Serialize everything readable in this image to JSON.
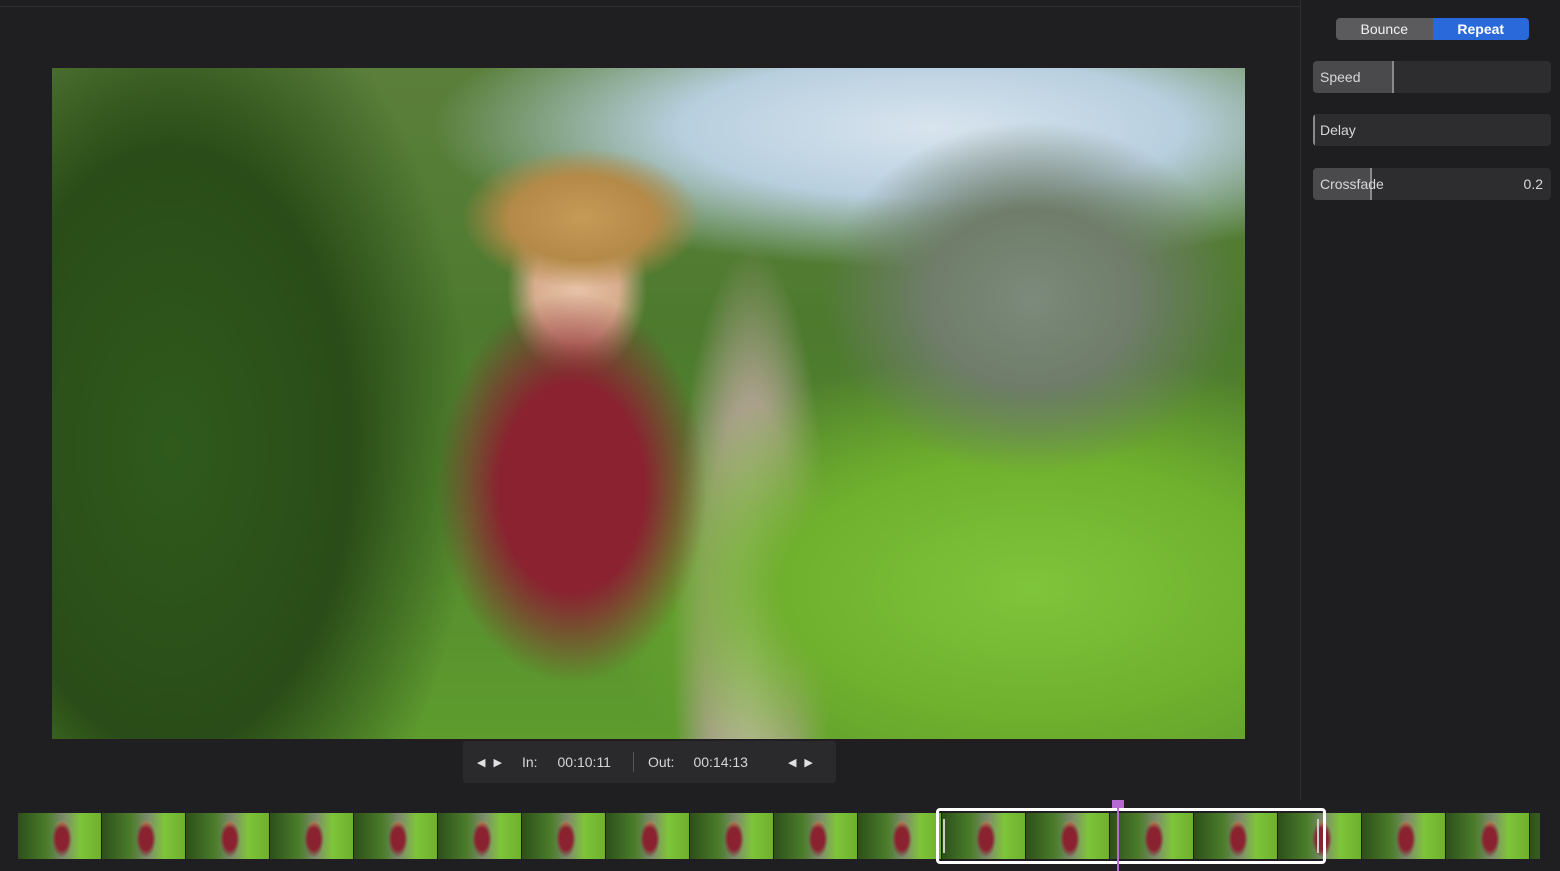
{
  "right_panel": {
    "mode_buttons": [
      {
        "label": "Bounce",
        "active": false
      },
      {
        "label": "Repeat",
        "active": true
      }
    ],
    "sliders": [
      {
        "label": "Speed",
        "value": null,
        "level": 0.33
      },
      {
        "label": "Delay",
        "value": null,
        "level": 0.0
      },
      {
        "label": "Crossfade",
        "value": "0.2",
        "level": 0.24
      }
    ]
  },
  "trim": {
    "in_label": "In:",
    "in_time": "00:10:11",
    "out_label": "Out:",
    "out_time": "00:14:13",
    "prev_glyph": "◀",
    "next_glyph": "▶"
  },
  "viewer": {
    "icon": "video-frame"
  },
  "colors": {
    "accent": "#2a69d9",
    "playhead": "#b56ad1",
    "background": "#1f1f21"
  }
}
